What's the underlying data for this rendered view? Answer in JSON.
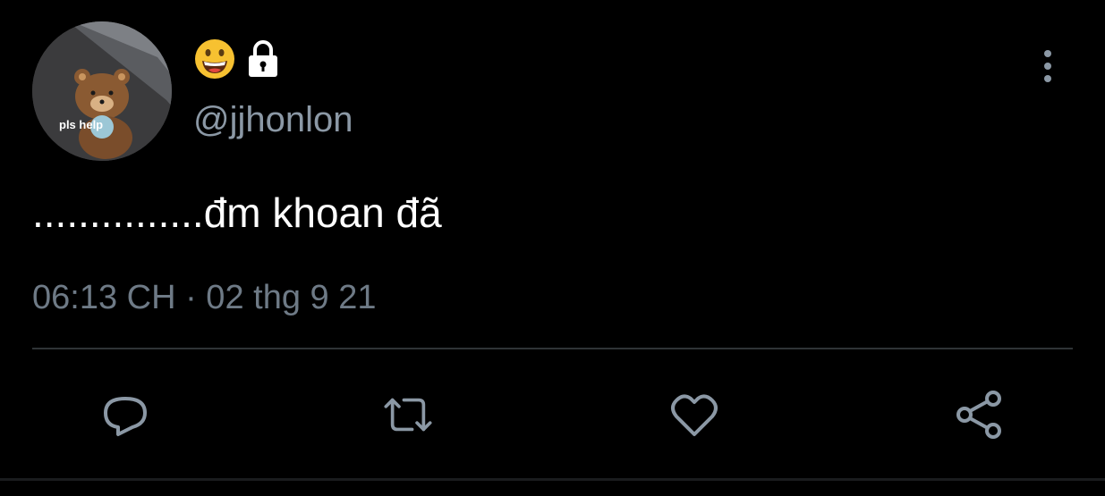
{
  "tweet": {
    "avatar": {
      "caption": "pls help"
    },
    "display_name_icons": [
      "grinning-face-emoji",
      "lock-icon"
    ],
    "handle": "@jjhonlon",
    "text": "...............đm khoan đã",
    "timestamp": "06:13 CH · 02 thg 9 21",
    "actions": [
      "reply-icon",
      "retweet-icon",
      "like-icon",
      "share-icon"
    ]
  },
  "colors": {
    "background": "#000000",
    "text_primary": "#ffffff",
    "text_secondary": "#8b98a5",
    "icon": "#8b98a5",
    "divider": "#2f3336"
  }
}
